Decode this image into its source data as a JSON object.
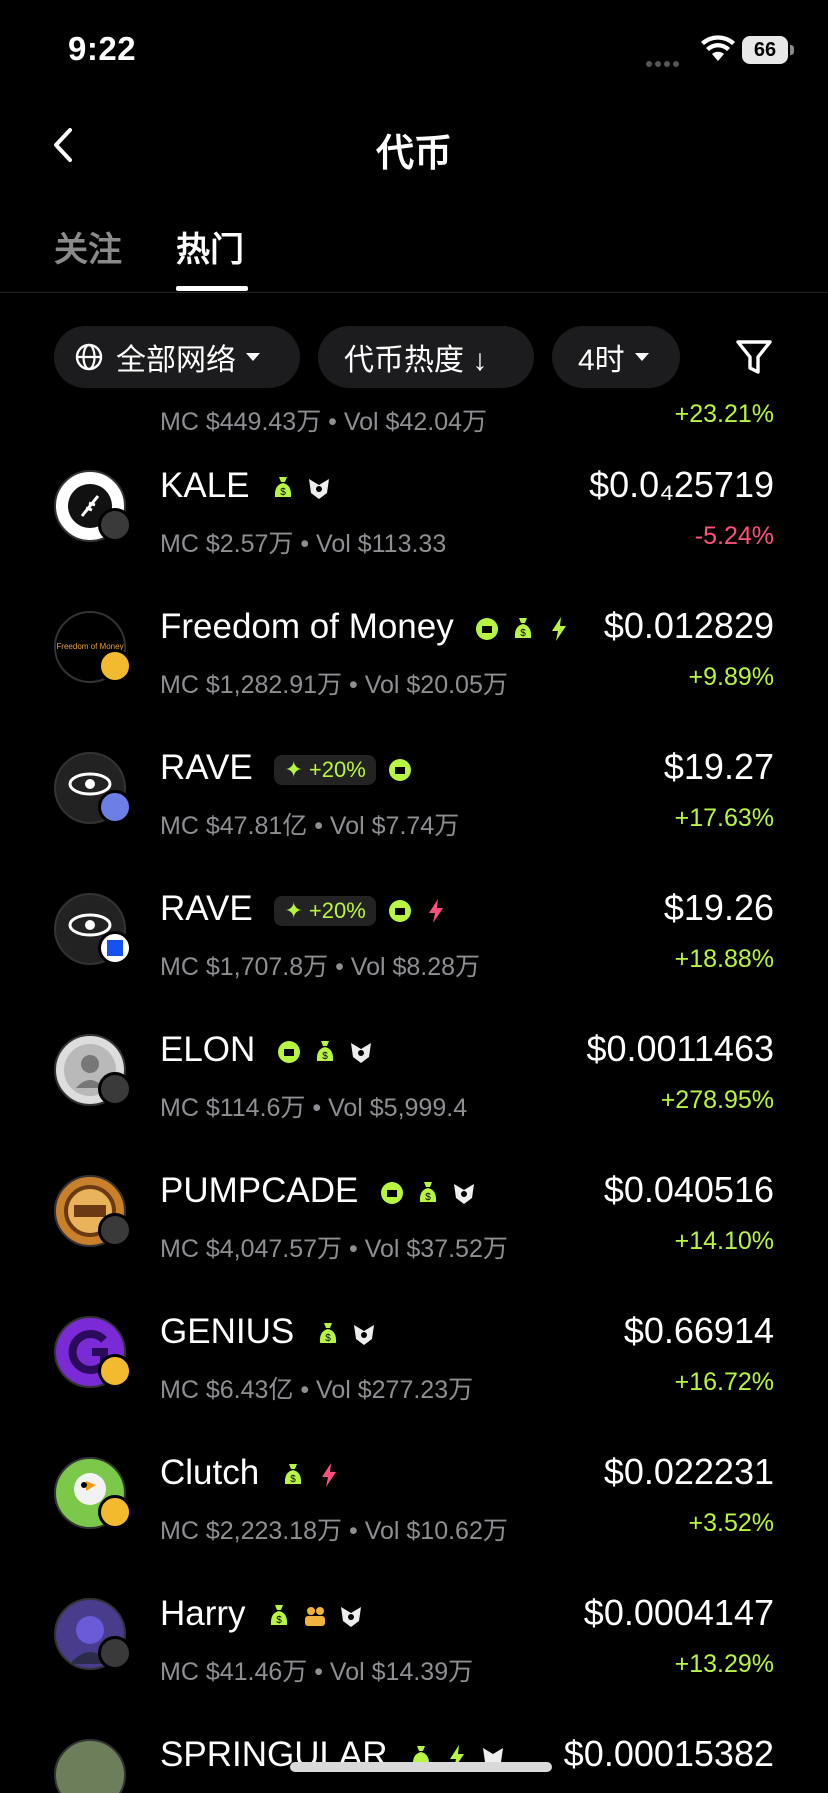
{
  "status": {
    "time": "9:22",
    "battery": "66"
  },
  "nav": {
    "title": "代币"
  },
  "tabs": {
    "following": "关注",
    "hot": "热门"
  },
  "filters": {
    "network": "全部网络",
    "sort": "代币热度 ↓",
    "period": "4时"
  },
  "top_partial": {
    "sub": "MC $449.43万 • Vol $42.04万",
    "change": "+23.21%"
  },
  "tokens": [
    {
      "name": "KALE",
      "sub": "MC $2.57万 • Vol $113.33",
      "price": "$0.0₄25719",
      "change": "-5.24%",
      "direction": "down",
      "chain": "sol"
    },
    {
      "name": "Freedom of Money",
      "sub": "MC $1,282.91万 • Vol $20.05万",
      "price": "$0.012829",
      "change": "+9.89%",
      "direction": "up",
      "chain": "bnb",
      "avatar_text": "Freedom of Money"
    },
    {
      "name": "RAVE",
      "promo": "+20%",
      "sub": "MC $47.81亿 • Vol $7.74万",
      "price": "$19.27",
      "change": "+17.63%",
      "direction": "up",
      "chain": "eth"
    },
    {
      "name": "RAVE",
      "promo": "+20%",
      "sub": "MC $1,707.8万 • Vol $8.28万",
      "price": "$19.26",
      "change": "+18.88%",
      "direction": "up",
      "chain": "base"
    },
    {
      "name": "ELON",
      "sub": "MC $114.6万 • Vol $5,999.4",
      "price": "$0.0011463",
      "change": "+278.95%",
      "direction": "up",
      "chain": "sol"
    },
    {
      "name": "PUMPCADE",
      "sub": "MC $4,047.57万 • Vol $37.52万",
      "price": "$0.040516",
      "change": "+14.10%",
      "direction": "up",
      "chain": "sol"
    },
    {
      "name": "GENIUS",
      "sub": "MC $6.43亿 • Vol $277.23万",
      "price": "$0.66914",
      "change": "+16.72%",
      "direction": "up",
      "chain": "bnb"
    },
    {
      "name": "Clutch",
      "sub": "MC $2,223.18万 • Vol $10.62万",
      "price": "$0.022231",
      "change": "+3.52%",
      "direction": "up",
      "chain": "bnb"
    },
    {
      "name": "Harry",
      "sub": "MC $41.46万 • Vol $14.39万",
      "price": "$0.0004147",
      "change": "+13.29%",
      "direction": "up",
      "chain": "sol"
    },
    {
      "name": "SPRINGULAR",
      "price": "$0.00015382"
    }
  ],
  "colors": {
    "accent_green": "#b8f542",
    "negative_pink": "#ff4f7b",
    "muted_gray": "#8e8e93",
    "chip_bg": "#1c1c1e"
  }
}
